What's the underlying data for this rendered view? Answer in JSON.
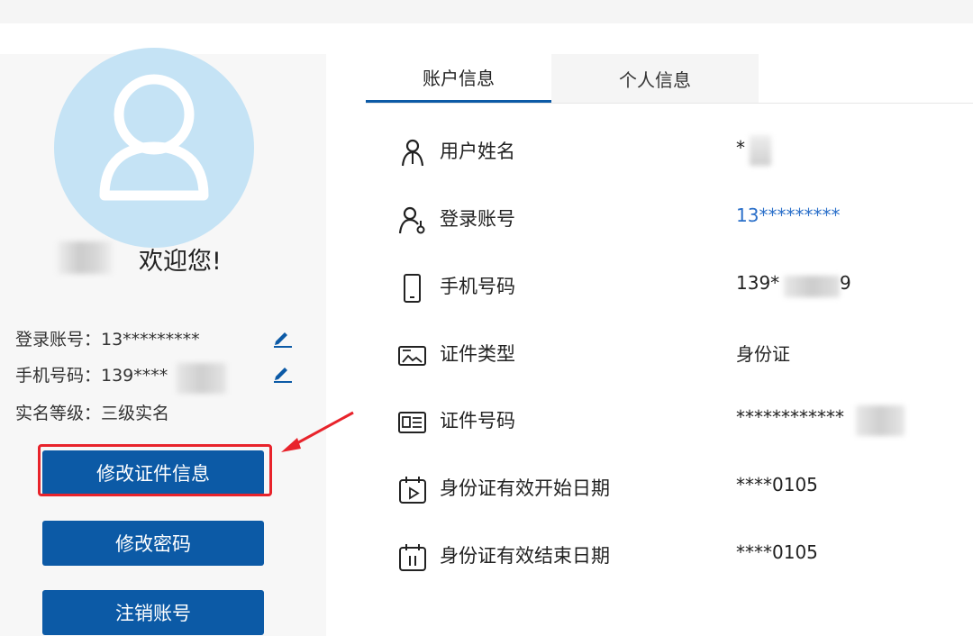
{
  "sidebar": {
    "welcome": "欢迎您!",
    "login_account": "登录账号：13*********",
    "phone_number": "手机号码：139****",
    "real_name_level": "实名等级：三级实名",
    "buttons": {
      "modify_id": "修改证件信息",
      "modify_password": "修改密码",
      "cancel_account": "注销账号"
    }
  },
  "tabs": [
    {
      "label": "账户信息",
      "active": true
    },
    {
      "label": "个人信息",
      "active": false
    }
  ],
  "account_info": {
    "rows": [
      {
        "label": "用户姓名",
        "value": "*",
        "icon": "user-icon"
      },
      {
        "label": "登录账号",
        "value": "13*********",
        "icon": "user-key-icon"
      },
      {
        "label": "手机号码",
        "value": "139*",
        "value_tail": "9",
        "icon": "phone-icon"
      },
      {
        "label": "证件类型",
        "value": "身份证",
        "icon": "id-card-type-icon"
      },
      {
        "label": "证件号码",
        "value": "************",
        "icon": "id-number-icon"
      },
      {
        "label": "身份证有效开始日期",
        "value": "****0105",
        "icon": "calendar-start-icon"
      },
      {
        "label": "身份证有效结束日期",
        "value": "****0105",
        "icon": "calendar-end-icon"
      }
    ]
  },
  "colors": {
    "primary": "#0c5aa6",
    "link": "#2a6fc9",
    "highlight": "#e8232b",
    "avatar_bg": "#c5e3f5"
  }
}
